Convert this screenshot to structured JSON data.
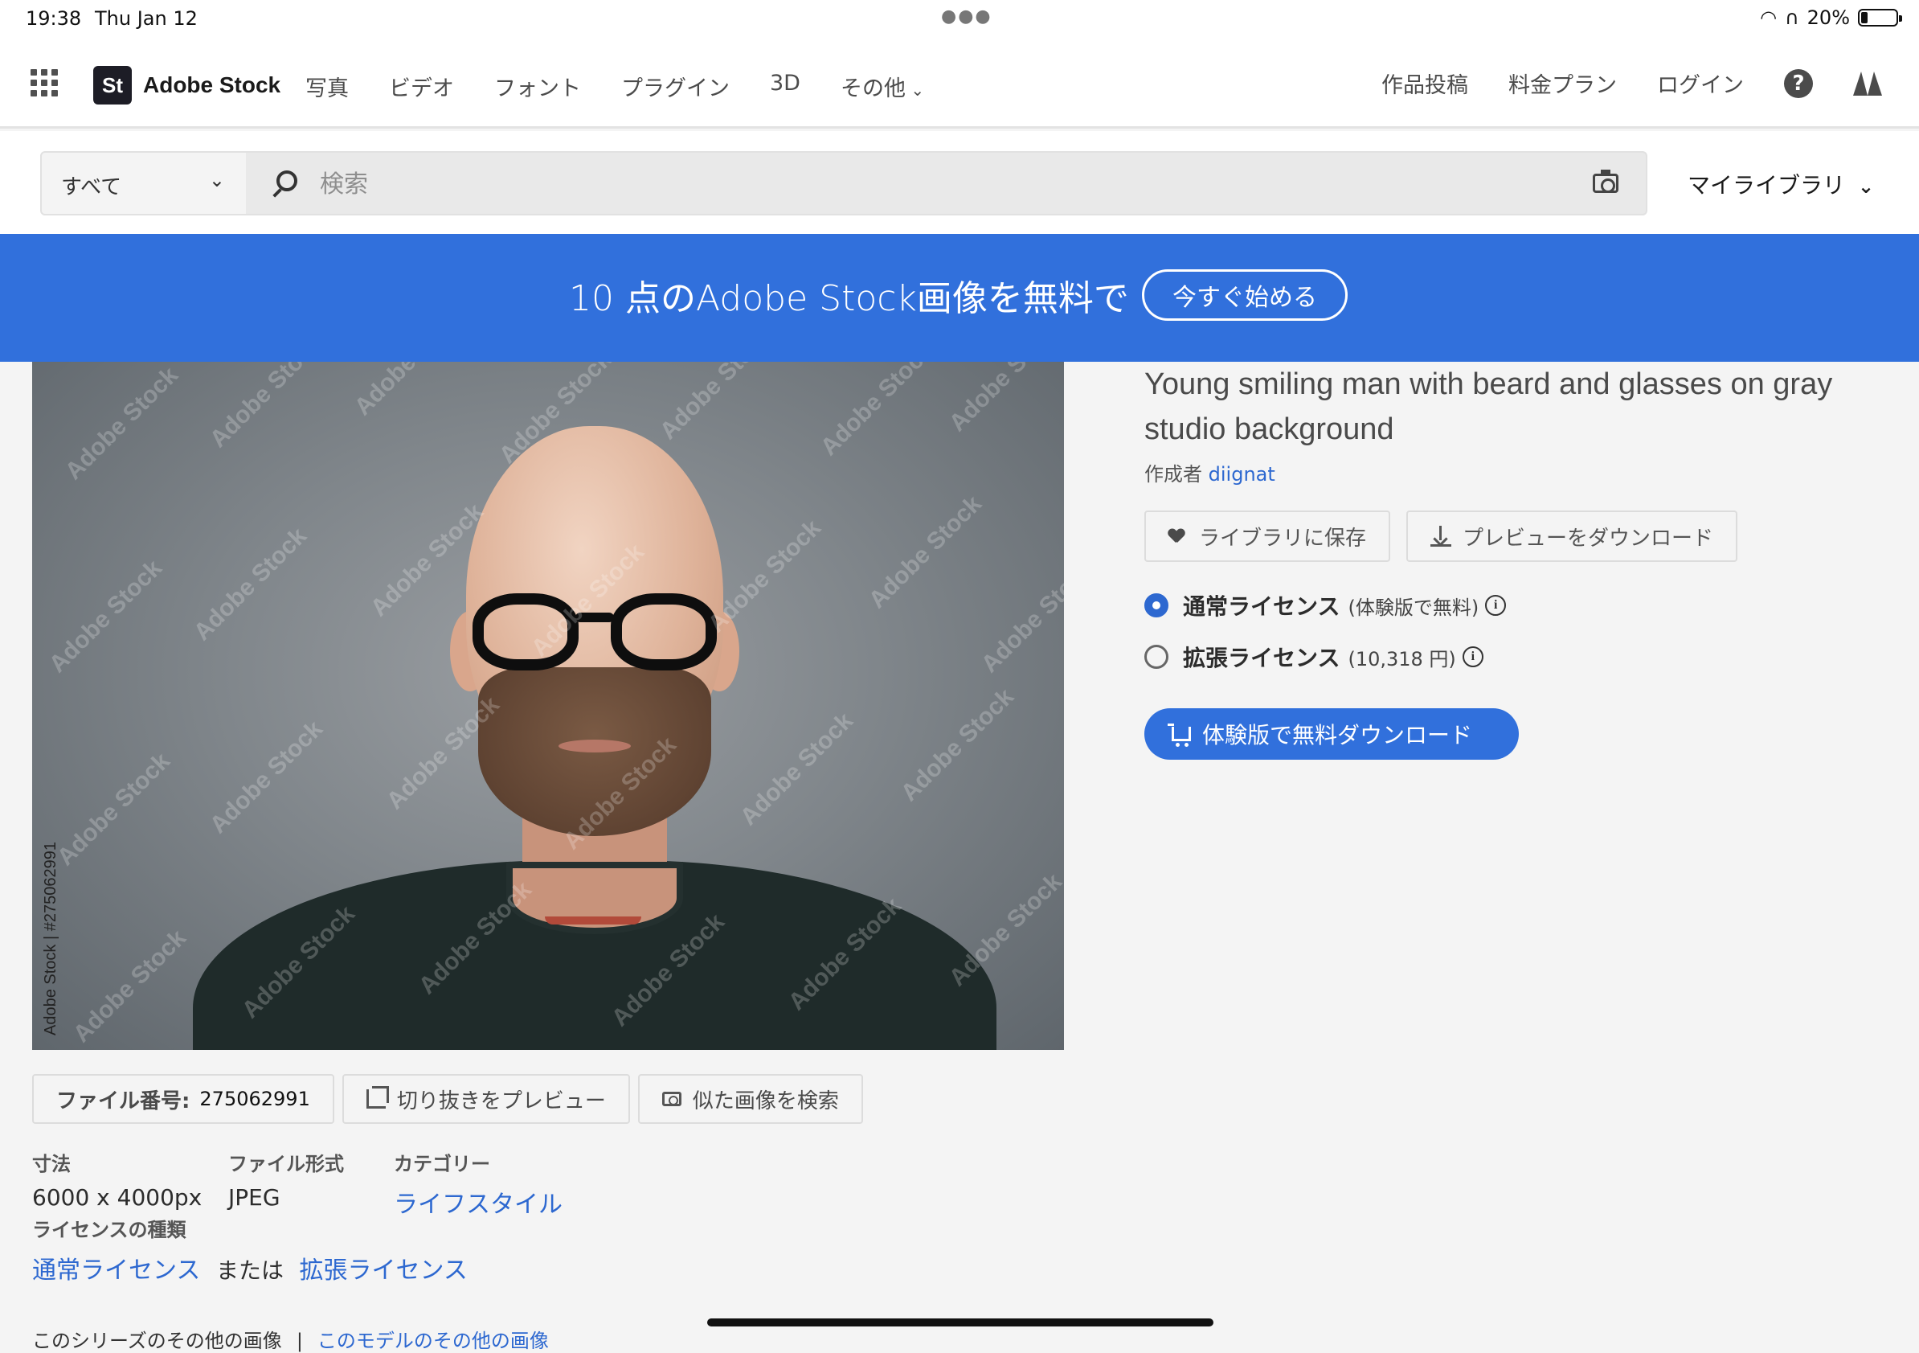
{
  "status_bar": {
    "time": "19:38",
    "date": "Thu Jan 12",
    "battery_percent": "20%",
    "battery_level": 0.2
  },
  "header": {
    "brand_logo": "St",
    "brand_name": "Adobe Stock",
    "nav": [
      "写真",
      "ビデオ",
      "フォント",
      "プラグイン",
      "3D",
      "その他"
    ],
    "right": {
      "contribute": "作品投稿",
      "pricing": "料金プラン",
      "login": "ログイン",
      "help": "?"
    }
  },
  "search": {
    "scope": "すべて",
    "placeholder": "検索",
    "value": "",
    "my_library": "マイライブラリ"
  },
  "promo": {
    "text": "10 点のAdobe Stock画像を無料で",
    "cta": "今すぐ始める",
    "color": "#3170dc"
  },
  "asset": {
    "watermark": "Adobe Stock",
    "side_credit": "Adobe Stock | #275062991",
    "title": "Young smiling man with beard and glasses on gray studio background",
    "author_prefix": "作成者",
    "author": "diignat",
    "save_to_library": "ライブラリに保存",
    "download_preview": "プレビューをダウンロード",
    "licenses": [
      {
        "label": "通常ライセンス",
        "detail": "(体験版で無料)",
        "selected": true
      },
      {
        "label": "拡張ライセンス",
        "detail": "(10,318 円)",
        "selected": false
      }
    ],
    "trial_download": "体験版で無料ダウンロード"
  },
  "file_bar": {
    "file_number_label": "ファイル番号:",
    "file_number": "275062991",
    "crop_preview": "切り抜きをプレビュー",
    "find_similar": "似た画像を検索"
  },
  "details": {
    "dimensions_label": "寸法",
    "dimensions": "6000 x 4000px",
    "format_label": "ファイル形式",
    "format": "JPEG",
    "category_label": "カテゴリー",
    "category": "ライフスタイル",
    "license_type_label": "ライセンスの種類",
    "license_standard": "通常ライセンス",
    "license_or": "または",
    "license_extended": "拡張ライセンス"
  },
  "series": {
    "more_in_series": "このシリーズのその他の画像",
    "separator": "|",
    "more_with_model": "このモデルのその他の画像"
  },
  "colors": {
    "accent": "#3170dc",
    "link": "#2d68d0"
  }
}
